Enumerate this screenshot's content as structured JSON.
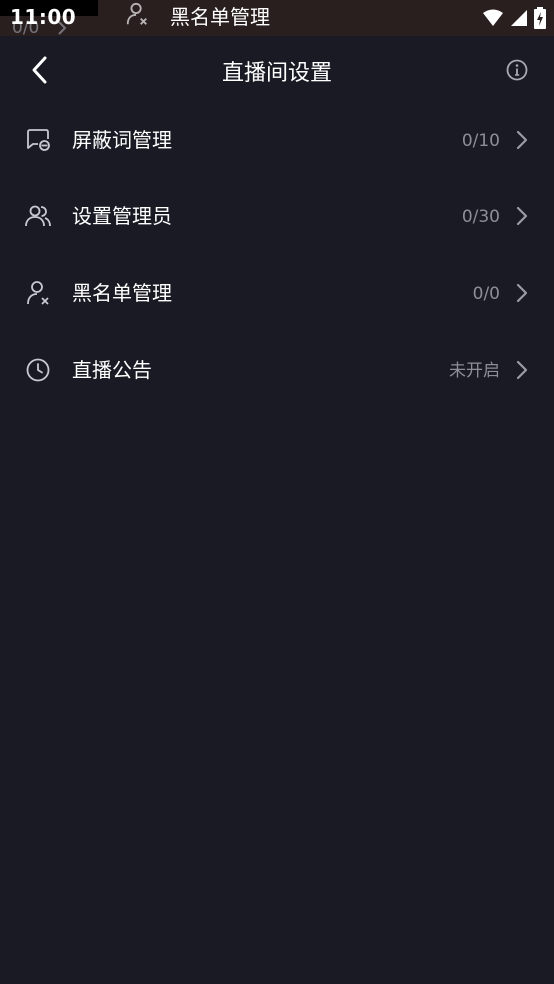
{
  "status_bar": {
    "time": "11:00",
    "ghost_overlay": {
      "count": "0/0",
      "title": "黑名单管理",
      "icon": "user-x-icon"
    }
  },
  "header": {
    "title": "直播间设置",
    "back_icon": "chevron-left-icon",
    "info_icon": "info-icon"
  },
  "menu": {
    "items": [
      {
        "label": "屏蔽词管理",
        "value": "0/10",
        "icon": "chat-block-icon"
      },
      {
        "label": "设置管理员",
        "value": "0/30",
        "icon": "users-icon"
      },
      {
        "label": "黑名单管理",
        "value": "0/0",
        "icon": "user-x-icon"
      },
      {
        "label": "直播公告",
        "value": "未开启",
        "icon": "clock-icon"
      }
    ]
  },
  "colors": {
    "background": "#191a24",
    "status_bar": "#2a1f1f",
    "text_primary": "#ffffff",
    "text_secondary": "#8d8e98"
  }
}
